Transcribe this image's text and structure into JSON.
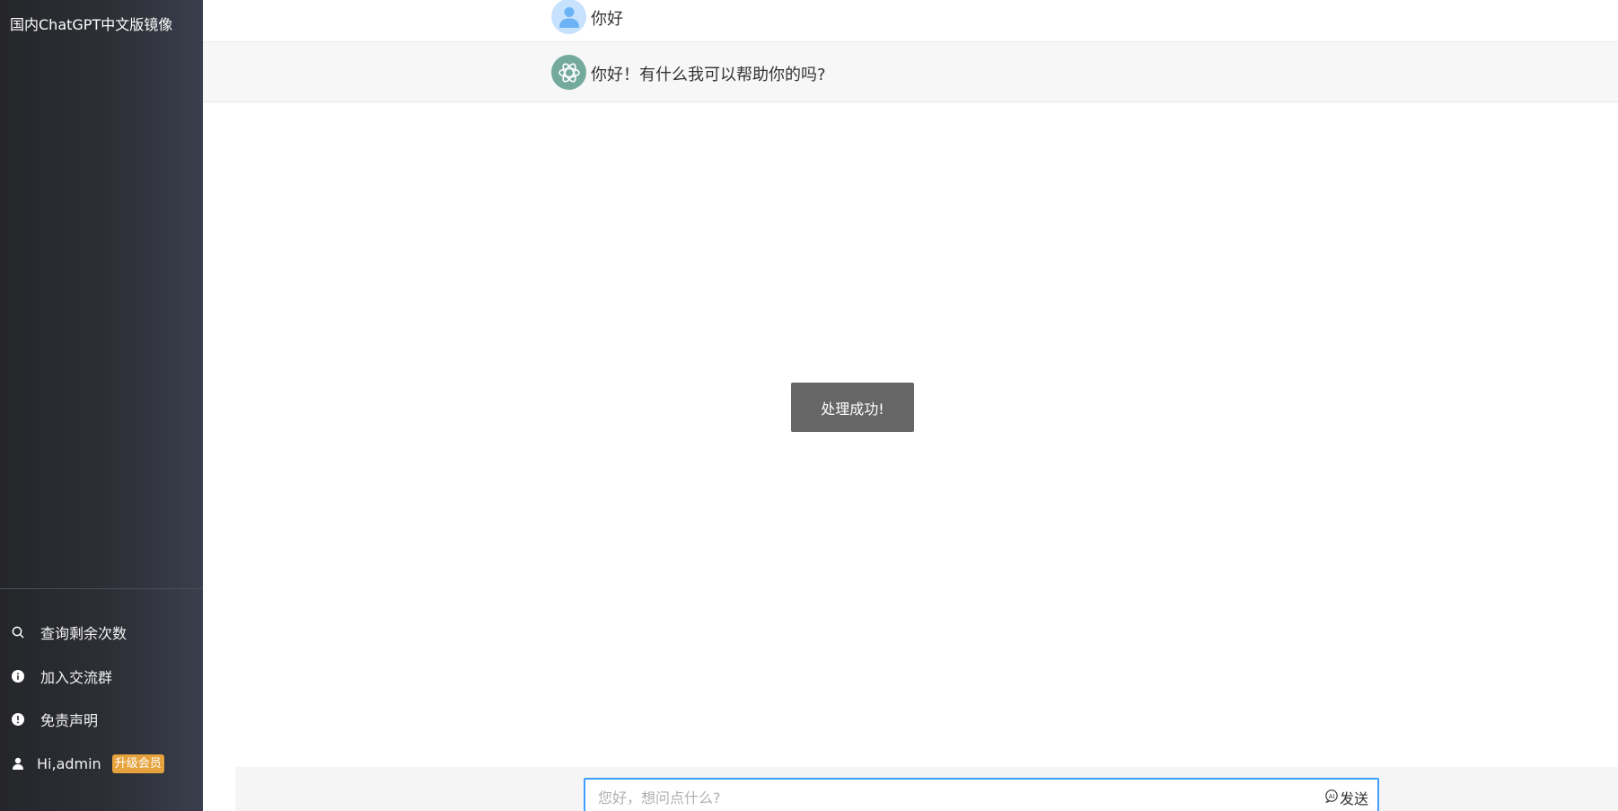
{
  "sidebar": {
    "brand": "国内ChatGPT中文版镜像",
    "items": [
      {
        "label": "查询剩余次数",
        "icon": "search-icon"
      },
      {
        "label": "加入交流群",
        "icon": "info-icon"
      },
      {
        "label": "免责声明",
        "icon": "warning-icon"
      },
      {
        "label": "Hi,admin",
        "icon": "user-icon"
      }
    ],
    "upgrade_label": "升级会员",
    "upgrade_color": "#e6a23c"
  },
  "chat": {
    "messages": [
      {
        "role": "user",
        "text": "你好",
        "avatar": "user-avatar-icon"
      },
      {
        "role": "assistant",
        "text": "你好！有什么我可以帮助你的吗?",
        "avatar": "openai-logo-icon"
      }
    ]
  },
  "toast": {
    "text": "处理成功!"
  },
  "composer": {
    "placeholder": "您好，想问点什么?",
    "value": "",
    "send_label": "发送",
    "send_icon": "ai-chat-icon",
    "focus_color": "#409eff"
  }
}
